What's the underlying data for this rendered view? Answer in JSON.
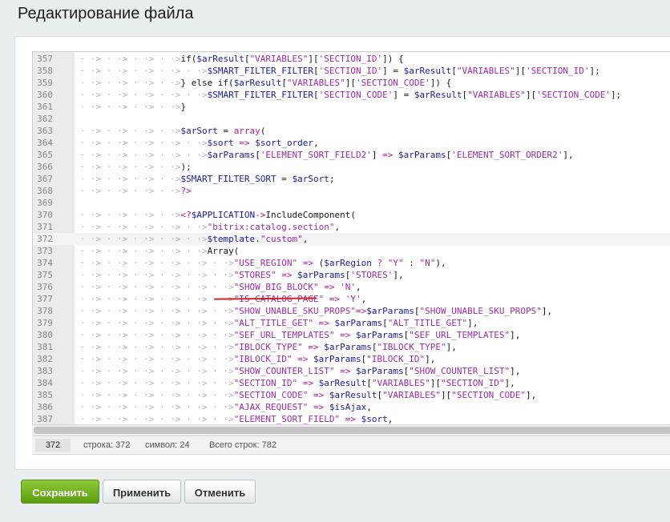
{
  "page": {
    "title": "Редактирование файла"
  },
  "editor": {
    "lines": [
      {
        "num": "357",
        "indent": 4,
        "tokens": [
          [
            "txt",
            "if("
          ],
          [
            "var",
            "$arResult"
          ],
          [
            "txt",
            "["
          ],
          [
            "str",
            "\"VARIABLES\""
          ],
          [
            "txt",
            "]["
          ],
          [
            "str",
            "'SECTION_ID'"
          ],
          [
            "txt",
            "]) {"
          ]
        ]
      },
      {
        "num": "358",
        "indent": 5,
        "tokens": [
          [
            "var",
            "$SMART_FILTER_FILTER"
          ],
          [
            "txt",
            "["
          ],
          [
            "str",
            "'SECTION_ID'"
          ],
          [
            "txt",
            "] = "
          ],
          [
            "var",
            "$arResult"
          ],
          [
            "txt",
            "["
          ],
          [
            "str",
            "\"VARIABLES\""
          ],
          [
            "txt",
            "]["
          ],
          [
            "str",
            "'SECTION_ID'"
          ],
          [
            "txt",
            "];"
          ]
        ]
      },
      {
        "num": "359",
        "indent": 4,
        "tokens": [
          [
            "txt",
            "} else if("
          ],
          [
            "var",
            "$arResult"
          ],
          [
            "txt",
            "["
          ],
          [
            "str",
            "\"VARIABLES\""
          ],
          [
            "txt",
            "]["
          ],
          [
            "str",
            "'SECTION_CODE'"
          ],
          [
            "txt",
            "]) {"
          ]
        ]
      },
      {
        "num": "360",
        "indent": 5,
        "tokens": [
          [
            "var",
            "$SMART_FILTER_FILTER"
          ],
          [
            "txt",
            "["
          ],
          [
            "str",
            "'SECTION_CODE'"
          ],
          [
            "txt",
            "] = "
          ],
          [
            "var",
            "$arResult"
          ],
          [
            "txt",
            "["
          ],
          [
            "str",
            "\"VARIABLES\""
          ],
          [
            "txt",
            "]["
          ],
          [
            "str",
            "'SECTION_CODE'"
          ],
          [
            "txt",
            "];"
          ]
        ]
      },
      {
        "num": "361",
        "indent": 4,
        "tokens": [
          [
            "txt",
            "}"
          ]
        ]
      },
      {
        "num": "362",
        "indent": 0,
        "tokens": []
      },
      {
        "num": "363",
        "indent": 4,
        "tokens": [
          [
            "var",
            "$arSort"
          ],
          [
            "txt",
            " = "
          ],
          [
            "op",
            "array"
          ],
          [
            "txt",
            "("
          ]
        ]
      },
      {
        "num": "364",
        "indent": 5,
        "tokens": [
          [
            "var",
            "$sort"
          ],
          [
            "txt",
            " "
          ],
          [
            "op",
            "=>"
          ],
          [
            "txt",
            " "
          ],
          [
            "var",
            "$sort_order"
          ],
          [
            "txt",
            ","
          ]
        ]
      },
      {
        "num": "365",
        "indent": 5,
        "tokens": [
          [
            "var",
            "$arParams"
          ],
          [
            "txt",
            "["
          ],
          [
            "str",
            "'ELEMENT_SORT_FIELD2'"
          ],
          [
            "txt",
            "] "
          ],
          [
            "op",
            "=>"
          ],
          [
            "txt",
            " "
          ],
          [
            "var",
            "$arParams"
          ],
          [
            "txt",
            "["
          ],
          [
            "str",
            "'ELEMENT_SORT_ORDER2'"
          ],
          [
            "txt",
            "],"
          ]
        ]
      },
      {
        "num": "366",
        "indent": 4,
        "tokens": [
          [
            "txt",
            ");"
          ]
        ]
      },
      {
        "num": "367",
        "indent": 4,
        "tokens": [
          [
            "var",
            "$SMART_FILTER_SORT"
          ],
          [
            "txt",
            " = "
          ],
          [
            "var",
            "$arSort"
          ],
          [
            "txt",
            ";"
          ]
        ]
      },
      {
        "num": "368",
        "indent": 4,
        "tokens": [
          [
            "op",
            "?>"
          ]
        ]
      },
      {
        "num": "369",
        "indent": 0,
        "tokens": []
      },
      {
        "num": "370",
        "indent": 4,
        "tokens": [
          [
            "op",
            "<?"
          ],
          [
            "var",
            "$APPLICATION"
          ],
          [
            "op",
            "->"
          ],
          [
            "txt",
            "IncludeComponent("
          ]
        ]
      },
      {
        "num": "371",
        "indent": 5,
        "tokens": [
          [
            "str",
            "\"bitrix:catalog.section\""
          ],
          [
            "txt",
            ","
          ]
        ]
      },
      {
        "num": "372",
        "indent": 5,
        "tokens": [
          [
            "var",
            "$template"
          ],
          [
            "txt",
            "."
          ],
          [
            "str",
            "\"custom\""
          ],
          [
            "txt",
            ","
          ]
        ]
      },
      {
        "num": "373",
        "indent": 5,
        "tokens": [
          [
            "txt",
            "Array("
          ]
        ]
      },
      {
        "num": "374",
        "indent": 6,
        "tokens": [
          [
            "str",
            "\"USE_REGION\""
          ],
          [
            "txt",
            " "
          ],
          [
            "op",
            "=>"
          ],
          [
            "txt",
            " ("
          ],
          [
            "var",
            "$arRegion"
          ],
          [
            "txt",
            " "
          ],
          [
            "op",
            "?"
          ],
          [
            "txt",
            " "
          ],
          [
            "str",
            "\"Y\""
          ],
          [
            "txt",
            " : "
          ],
          [
            "str",
            "\"N\""
          ],
          [
            "txt",
            "),"
          ]
        ]
      },
      {
        "num": "375",
        "indent": 6,
        "tokens": [
          [
            "str",
            "\"STORES\""
          ],
          [
            "txt",
            " "
          ],
          [
            "op",
            "=>"
          ],
          [
            "txt",
            " "
          ],
          [
            "var",
            "$arParams"
          ],
          [
            "txt",
            "["
          ],
          [
            "str",
            "'STORES'"
          ],
          [
            "txt",
            "],"
          ]
        ]
      },
      {
        "num": "376",
        "indent": 6,
        "tokens": [
          [
            "str",
            "\"SHOW_BIG_BLOCK\""
          ],
          [
            "txt",
            " "
          ],
          [
            "op",
            "=>"
          ],
          [
            "txt",
            " "
          ],
          [
            "str",
            "'N'"
          ],
          [
            "txt",
            ","
          ]
        ]
      },
      {
        "num": "377",
        "indent": 6,
        "tokens": [
          [
            "str",
            "\"IS_CATALOG_PAGE\""
          ],
          [
            "txt",
            " "
          ],
          [
            "op",
            "=>"
          ],
          [
            "txt",
            " "
          ],
          [
            "str",
            "'Y'"
          ],
          [
            "txt",
            ","
          ]
        ]
      },
      {
        "num": "378",
        "indent": 6,
        "tokens": [
          [
            "str",
            "\"SHOW_UNABLE_SKU_PROPS\""
          ],
          [
            "op",
            "=>"
          ],
          [
            "var",
            "$arParams"
          ],
          [
            "txt",
            "["
          ],
          [
            "str",
            "\"SHOW_UNABLE_SKU_PROPS\""
          ],
          [
            "txt",
            "],"
          ]
        ]
      },
      {
        "num": "379",
        "indent": 6,
        "tokens": [
          [
            "str",
            "\"ALT_TITLE_GET\""
          ],
          [
            "txt",
            " "
          ],
          [
            "op",
            "=>"
          ],
          [
            "txt",
            " "
          ],
          [
            "var",
            "$arParams"
          ],
          [
            "txt",
            "["
          ],
          [
            "str",
            "\"ALT_TITLE_GET\""
          ],
          [
            "txt",
            "],"
          ]
        ]
      },
      {
        "num": "380",
        "indent": 6,
        "tokens": [
          [
            "str",
            "\"SEF_URL_TEMPLATES\""
          ],
          [
            "txt",
            " "
          ],
          [
            "op",
            "=>"
          ],
          [
            "txt",
            " "
          ],
          [
            "var",
            "$arParams"
          ],
          [
            "txt",
            "["
          ],
          [
            "str",
            "\"SEF_URL_TEMPLATES\""
          ],
          [
            "txt",
            "],"
          ]
        ]
      },
      {
        "num": "381",
        "indent": 6,
        "tokens": [
          [
            "str",
            "\"IBLOCK_TYPE\""
          ],
          [
            "txt",
            " "
          ],
          [
            "op",
            "=>"
          ],
          [
            "txt",
            " "
          ],
          [
            "var",
            "$arParams"
          ],
          [
            "txt",
            "["
          ],
          [
            "str",
            "\"IBLOCK_TYPE\""
          ],
          [
            "txt",
            "],"
          ]
        ]
      },
      {
        "num": "382",
        "indent": 6,
        "tokens": [
          [
            "str",
            "\"IBLOCK_ID\""
          ],
          [
            "txt",
            " "
          ],
          [
            "op",
            "=>"
          ],
          [
            "txt",
            " "
          ],
          [
            "var",
            "$arParams"
          ],
          [
            "txt",
            "["
          ],
          [
            "str",
            "\"IBLOCK_ID\""
          ],
          [
            "txt",
            "],"
          ]
        ]
      },
      {
        "num": "383",
        "indent": 6,
        "tokens": [
          [
            "str",
            "\"SHOW_COUNTER_LIST\""
          ],
          [
            "txt",
            " "
          ],
          [
            "op",
            "=>"
          ],
          [
            "txt",
            " "
          ],
          [
            "var",
            "$arParams"
          ],
          [
            "txt",
            "["
          ],
          [
            "str",
            "\"SHOW_COUNTER_LIST\""
          ],
          [
            "txt",
            "],"
          ]
        ]
      },
      {
        "num": "384",
        "indent": 6,
        "tokens": [
          [
            "str",
            "\"SECTION_ID\""
          ],
          [
            "txt",
            " "
          ],
          [
            "op",
            "=>"
          ],
          [
            "txt",
            " "
          ],
          [
            "var",
            "$arResult"
          ],
          [
            "txt",
            "["
          ],
          [
            "str",
            "\"VARIABLES\""
          ],
          [
            "txt",
            "]["
          ],
          [
            "str",
            "\"SECTION_ID\""
          ],
          [
            "txt",
            "],"
          ]
        ]
      },
      {
        "num": "385",
        "indent": 6,
        "tokens": [
          [
            "str",
            "\"SECTION_CODE\""
          ],
          [
            "txt",
            " "
          ],
          [
            "op",
            "=>"
          ],
          [
            "txt",
            " "
          ],
          [
            "var",
            "$arResult"
          ],
          [
            "txt",
            "["
          ],
          [
            "str",
            "\"VARIABLES\""
          ],
          [
            "txt",
            "]["
          ],
          [
            "str",
            "\"SECTION_CODE\""
          ],
          [
            "txt",
            "],"
          ]
        ]
      },
      {
        "num": "386",
        "indent": 6,
        "tokens": [
          [
            "str",
            "\"AJAX_REQUEST\""
          ],
          [
            "txt",
            " "
          ],
          [
            "op",
            "=>"
          ],
          [
            "txt",
            " "
          ],
          [
            "var",
            "$isAjax"
          ],
          [
            "txt",
            ","
          ]
        ]
      },
      {
        "num": "387",
        "indent": 6,
        "tokens": [
          [
            "str",
            "\"ELEMENT_SORT_FIELD\""
          ],
          [
            "txt",
            " "
          ],
          [
            "op",
            "=>"
          ],
          [
            "txt",
            " "
          ],
          [
            "var",
            "$sort"
          ],
          [
            "txt",
            ","
          ]
        ]
      }
    ],
    "active_line": "372",
    "indent_glyph": "· · >"
  },
  "status": {
    "line_number": "372",
    "row": "строка: 372",
    "symbol": "символ: 24",
    "total": "Всего строк: 782"
  },
  "buttons": {
    "save": "Сохранить",
    "apply": "Применить",
    "cancel": "Отменить"
  },
  "colors": {
    "variable": "#1a1aa6",
    "string": "#9a2ea6",
    "operator": "#c2188f",
    "save_button": "#6aae17",
    "annotation_underline": "#c8242a"
  }
}
